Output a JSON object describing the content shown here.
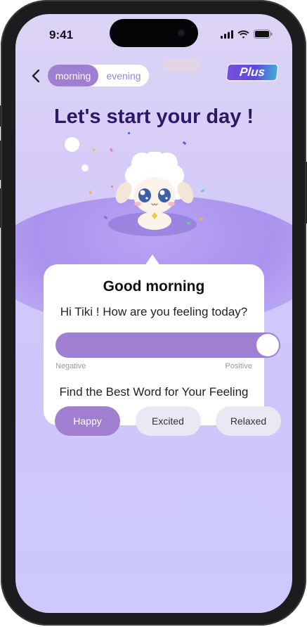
{
  "status_bar": {
    "time": "9:41"
  },
  "header": {
    "segments": [
      {
        "label": "morning",
        "active": true
      },
      {
        "label": "evening",
        "active": false
      }
    ],
    "plus_label": "Plus"
  },
  "headline": "Let's start your day !",
  "card": {
    "title": "Good morning",
    "question": "Hi Tiki ! How are you feeling today?",
    "slider": {
      "min_label": "Negative",
      "max_label": "Positive",
      "value": 1.0
    },
    "word_prompt": "Find the Best Word for Your Feeling",
    "options": [
      {
        "label": "Happy",
        "selected": true
      },
      {
        "label": "Excited",
        "selected": false
      },
      {
        "label": "Relaxed",
        "selected": false
      }
    ]
  },
  "colors": {
    "accent": "#9f7fd1",
    "headline": "#2a1a66",
    "background": "#d6ccf7"
  }
}
